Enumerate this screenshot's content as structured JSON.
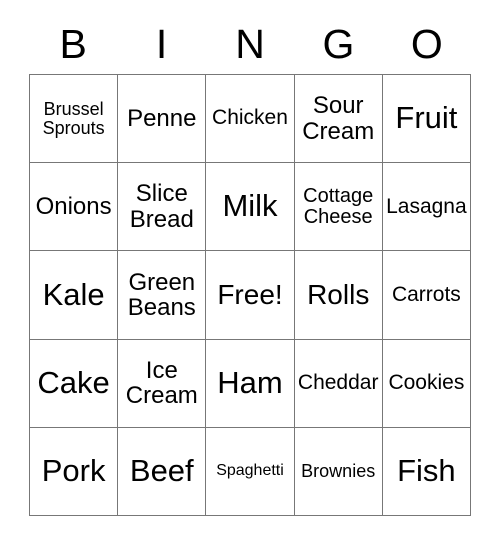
{
  "card": {
    "title": "BINGO",
    "header_letters": [
      "B",
      "I",
      "N",
      "G",
      "O"
    ],
    "grid_size": "5x5",
    "free_space_label": "Free!",
    "colors": {
      "background": "#ffffff",
      "text": "#000000",
      "grid_line": "#777777"
    },
    "rows": [
      [
        {
          "text": "Brussel\nSprouts",
          "size": "two-sm"
        },
        {
          "text": "Penne",
          "size": "ml"
        },
        {
          "text": "Chicken",
          "size": "md"
        },
        {
          "text": "Sour\nCream",
          "size": "two-lg"
        },
        {
          "text": "Fruit",
          "size": "xl"
        }
      ],
      [
        {
          "text": "Onions",
          "size": "ml"
        },
        {
          "text": "Slice\nBread",
          "size": "two-lg"
        },
        {
          "text": "Milk",
          "size": "xl"
        },
        {
          "text": "Cottage\nCheese",
          "size": "two-md"
        },
        {
          "text": "Lasagna",
          "size": "md"
        }
      ],
      [
        {
          "text": "Kale",
          "size": "xl"
        },
        {
          "text": "Green\nBeans",
          "size": "two-lg"
        },
        {
          "text": "Free!",
          "size": "lg"
        },
        {
          "text": "Rolls",
          "size": "lg"
        },
        {
          "text": "Carrots",
          "size": "md"
        }
      ],
      [
        {
          "text": "Cake",
          "size": "xl"
        },
        {
          "text": "Ice\nCream",
          "size": "two-lg"
        },
        {
          "text": "Ham",
          "size": "xl"
        },
        {
          "text": "Cheddar",
          "size": "md"
        },
        {
          "text": "Cookies",
          "size": "md"
        }
      ],
      [
        {
          "text": "Pork",
          "size": "xl"
        },
        {
          "text": "Beef",
          "size": "xl"
        },
        {
          "text": "Spaghetti",
          "size": "xs"
        },
        {
          "text": "Brownies",
          "size": "sm"
        },
        {
          "text": "Fish",
          "size": "xl"
        }
      ]
    ]
  }
}
